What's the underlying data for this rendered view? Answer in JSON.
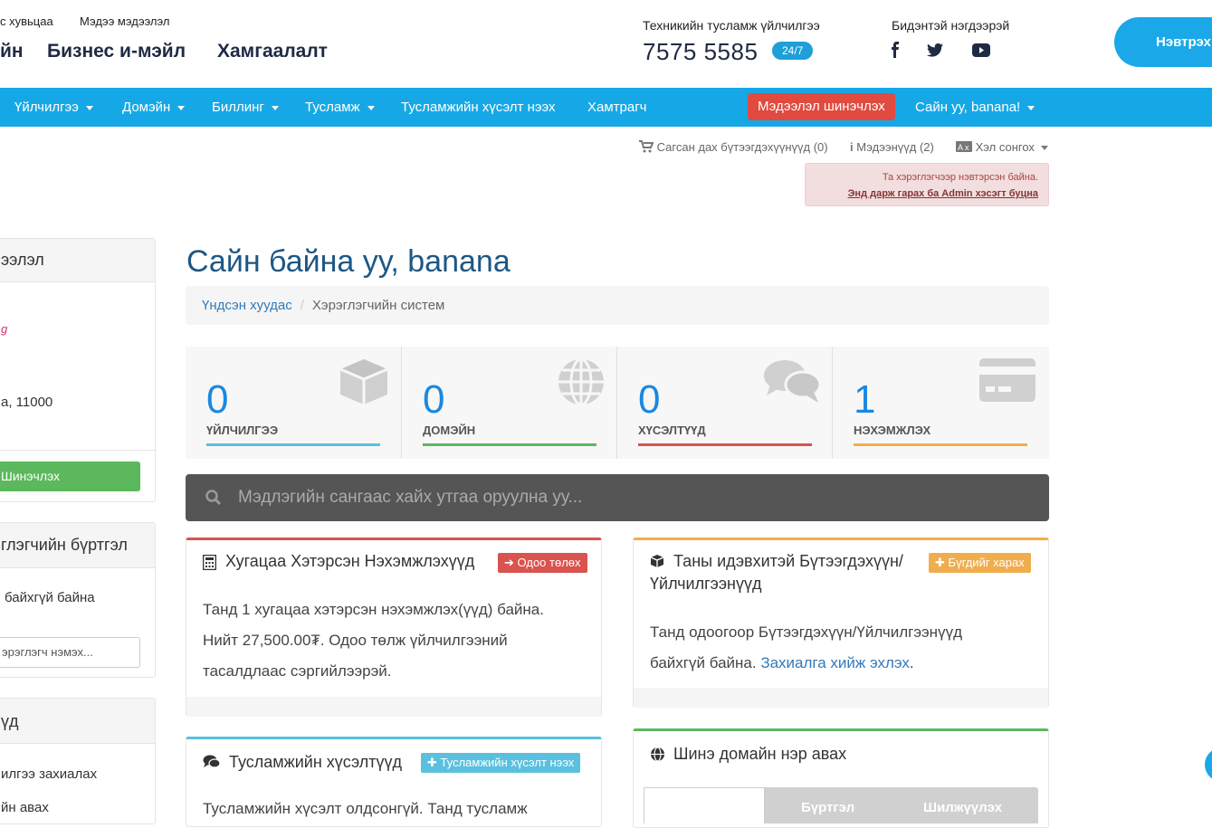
{
  "header": {
    "small_links": [
      "с хувьцаа",
      "Мэдээ мэдээлэл"
    ],
    "big_links": [
      "йн",
      "Бизнес и-мэйл",
      "Хамгаалалт"
    ],
    "support_title": "Техникийн тусламж үйлчилгээ",
    "phone": "7575 5585",
    "badge": "24/7",
    "social_title": "Бидэнтэй нэгдээрэй",
    "login_label": "Нэвтрэх"
  },
  "nav": {
    "items": [
      "Үйлчилгээ",
      "Домэйн",
      "Биллинг",
      "Тусламж",
      "Тусламжийн хүсэлт нээх",
      "Хамтрагч"
    ],
    "update_label": "Мэдээлэл шинэчлэх",
    "user_label": "Сайн уу, banana!"
  },
  "subtop": {
    "cart": "Сагсан дах бүтээгдэхүүнүүд (0)",
    "notifications": "Мэдээнүүд (2)",
    "language": "Хэл сонгох"
  },
  "alert": {
    "line1": "Та хэрэглэгчээр нэвтэрсэн байна.",
    "line2": "Энд дарж гарах ба Admin хэсэгт буцна"
  },
  "sidebar": {
    "panel1": {
      "title": "ээлэл",
      "pink_text": "g",
      "address": "a, 11000",
      "button": "Шинэчлэх"
    },
    "panel2": {
      "title": "глэгчийн бүртгэл",
      "text": "байхгүй байна",
      "input_placeholder": "эрэглэгч нэмэх..."
    },
    "panel3": {
      "title": "үд",
      "item1": "илгээ захиалах",
      "item2": "йн авах"
    }
  },
  "main": {
    "title": "Сайн байна уу, banana",
    "breadcrumb": {
      "home": "Үндсэн хуудас",
      "current": "Хэрэглэгчийн систем"
    },
    "stats": [
      {
        "value": "0",
        "label": "ҮЙЛЧИЛГЭЭ",
        "color": "#5bc0de"
      },
      {
        "value": "0",
        "label": "ДОМЭЙН",
        "color": "#5cb85c"
      },
      {
        "value": "0",
        "label": "ХҮСЭЛТҮҮД",
        "color": "#d9534f"
      },
      {
        "value": "1",
        "label": "НЭХЭМЖЛЭХ",
        "color": "#f0ad4e"
      }
    ],
    "search_placeholder": "Мэдлэгийн сангаас хайх утгаа оруулна уу...",
    "overdue": {
      "title": "Хугацаа Хэтэрсэн Нэхэмжлэхүүд",
      "button": "Одоо төлөх",
      "line1": "Танд 1 хугацаа хэтэрсэн нэхэмжлэх(үүд) байна.",
      "line2": "Нийт 27,500.00₮. Одоо төлж үйлчилгээний",
      "line3": "тасалдлаас сэргийлээрэй."
    },
    "active_products": {
      "title1": "Таны идэвхитэй Бүтээгдэхүүн/",
      "title2": "Үйлчилгээнүүд",
      "button": "Бүгдийг харах",
      "line1": "Танд одоогоор Бүтээгдэхүүн/Үйлчилгээнүүд",
      "line2": "байхгүй байна.",
      "link": "Захиалга хийж эхлэх"
    },
    "tickets": {
      "title": "Тусламжийн хүсэлтүүд",
      "button": "Тусламжийн хүсэлт нээх",
      "line1": "Тусламжийн хүсэлт олдсонгүй. Танд тусламж"
    },
    "domain": {
      "title": "Шинэ домайн нэр авах",
      "tab2": "Бүртгэл",
      "tab3": "Шилжүүлэх"
    }
  }
}
